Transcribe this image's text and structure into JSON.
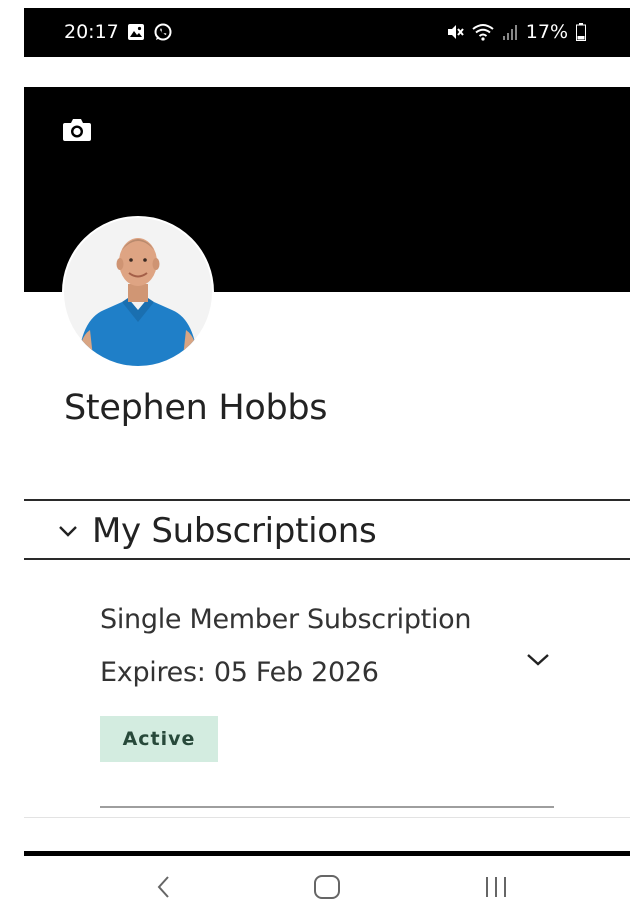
{
  "status_bar": {
    "time": "20:17",
    "battery": "17%",
    "icons_left": [
      "gallery-icon",
      "whatsapp-icon"
    ],
    "icons_right": [
      "mute-icon",
      "wifi-icon",
      "signal-icon",
      "battery-icon"
    ]
  },
  "profile": {
    "cover_color": "#000000",
    "camera_icon": "camera-icon",
    "name": "Stephen Hobbs"
  },
  "subscriptions_section": {
    "title": "My Subscriptions",
    "expanded": true,
    "items": [
      {
        "name": "Single Member Subscription",
        "expiry": "Expires: 05 Feb 2026",
        "status": "Active",
        "status_color": "#d3ece0"
      }
    ]
  },
  "nav_bar": {
    "buttons": [
      "back-icon",
      "home-icon",
      "recent-apps-icon"
    ]
  }
}
